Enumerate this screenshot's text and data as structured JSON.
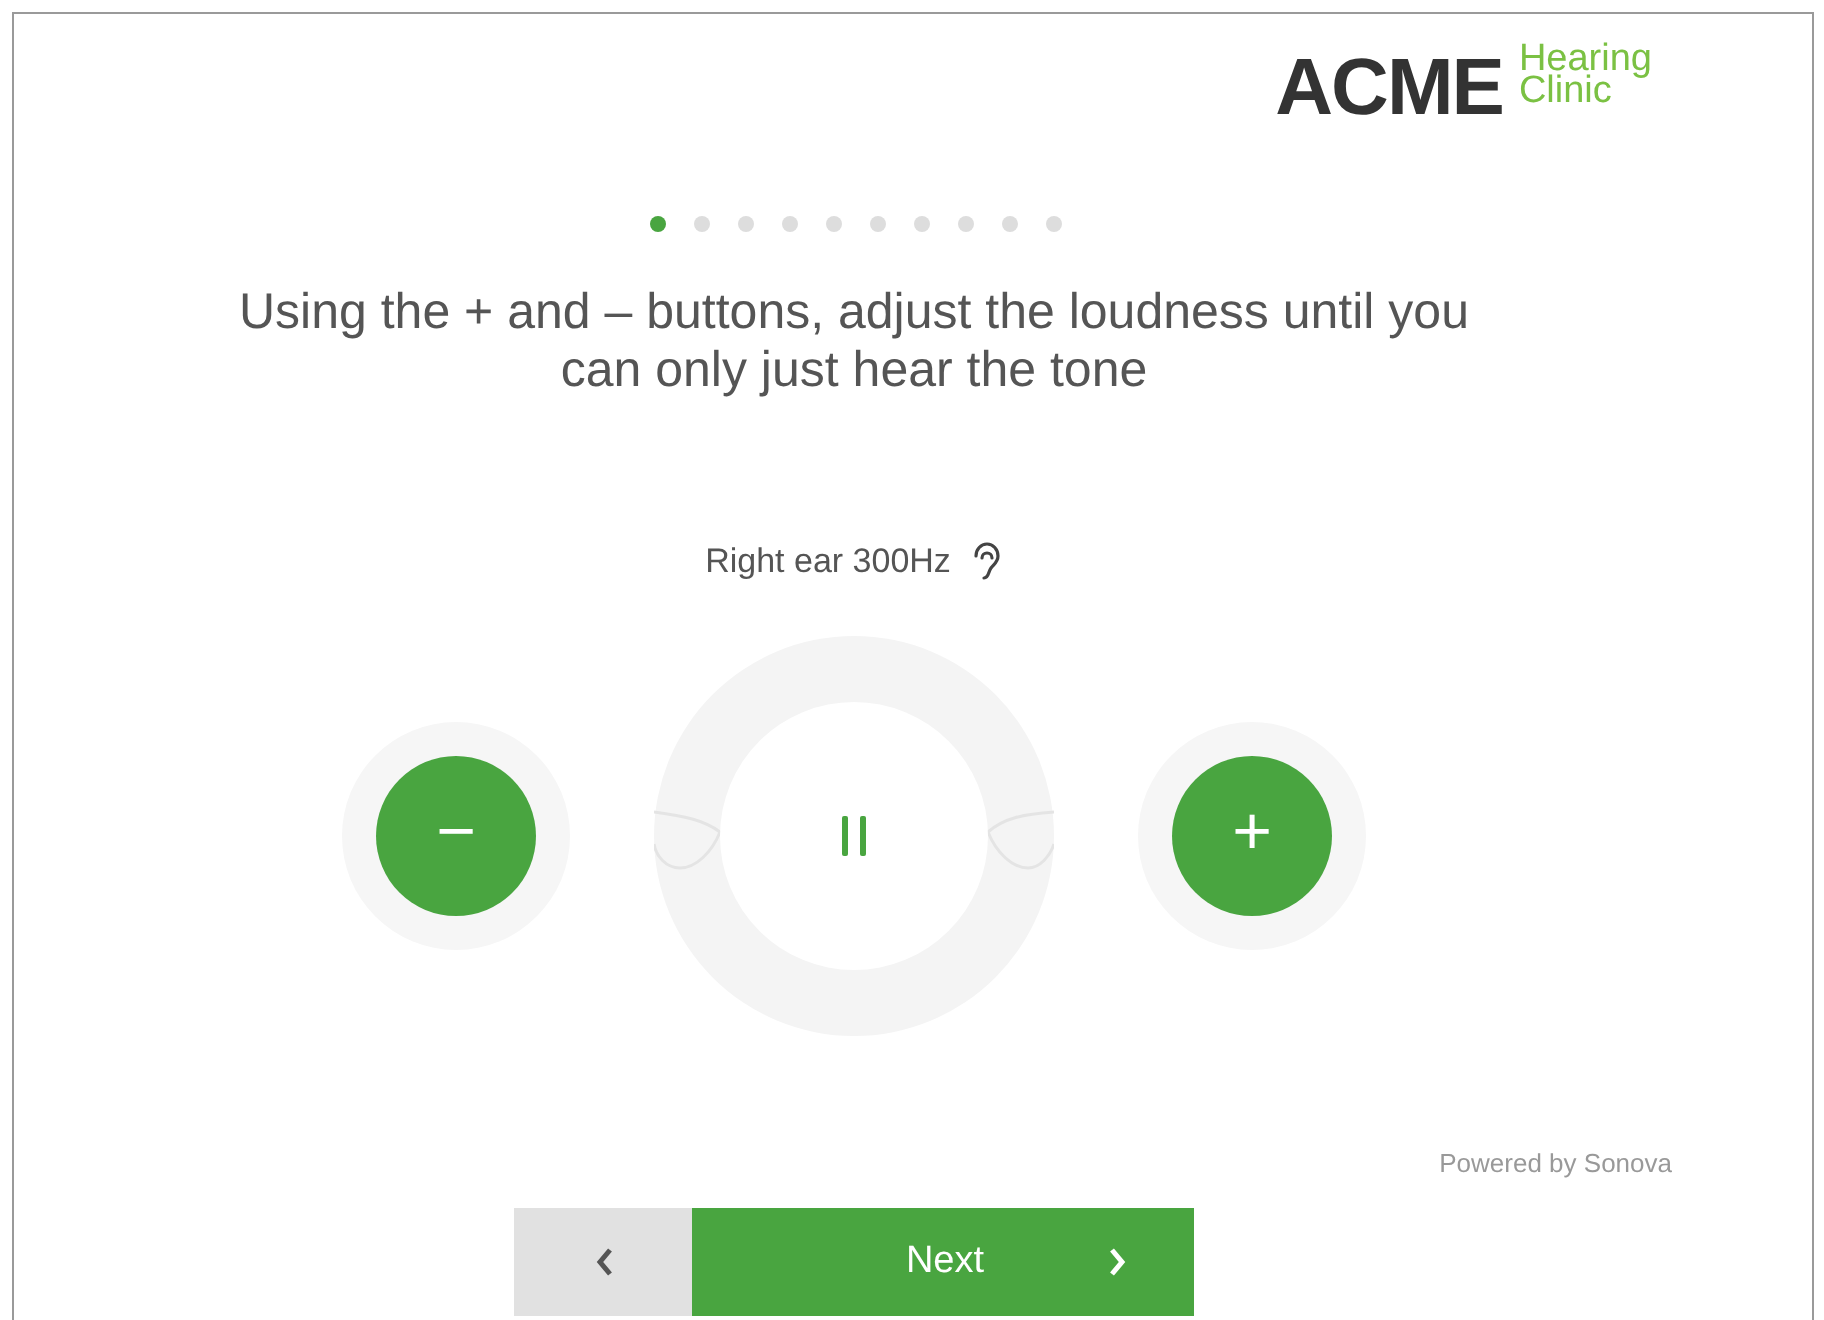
{
  "logo": {
    "brand": "ACME",
    "subtitle": [
      "Hearing",
      "Clinic"
    ]
  },
  "steps": [
    {
      "selected": true
    },
    {
      "selected": false
    },
    {
      "selected": false
    },
    {
      "selected": false
    },
    {
      "selected": false
    },
    {
      "selected": false
    },
    {
      "selected": false
    },
    {
      "selected": false
    },
    {
      "selected": false
    },
    {
      "selected": false
    }
  ],
  "instruction": "Using the + and – buttons, adjust the loudness until you can only just hear the tone",
  "tone_label": "Right ear 300Hz",
  "decrease_button": "−",
  "increase_button": "+",
  "playing": true,
  "powered_by": "Powered by Sonova",
  "next_button": "Next"
}
